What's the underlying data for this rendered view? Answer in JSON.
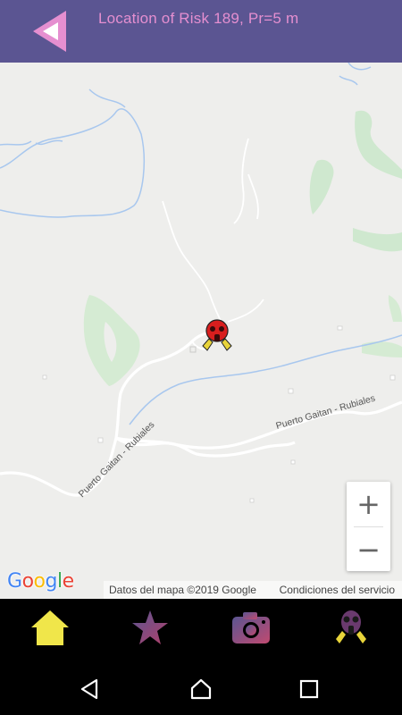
{
  "app_bar": {
    "title": "Location of Risk 189, Pr=5 m",
    "accent_color": "#5b5592",
    "title_color": "#e58fd0",
    "back_icon": "back-triangle-icon"
  },
  "map": {
    "road_labels": [
      "Puerto Gaitan - Rubiales",
      "Puerto Gaitan - Rubiales"
    ],
    "zoom_in_label": "+",
    "zoom_out_label": "−",
    "logo_letters": [
      "G",
      "o",
      "o",
      "g",
      "l",
      "e"
    ],
    "attribution": "Datos del mapa ©2019 Google",
    "terms": "Condiciones del servicio",
    "marker_icon": "gas-mask-marker-icon"
  },
  "bottom_nav": {
    "items": [
      {
        "icon": "home-icon",
        "color": "#f0e64a"
      },
      {
        "icon": "star-icon",
        "color": "#8b3a6e"
      },
      {
        "icon": "camera-icon",
        "color": "#a04a7a"
      },
      {
        "icon": "gas-mask-icon",
        "color": "#7a3a78"
      }
    ]
  },
  "system_nav": {
    "buttons": [
      "back-nav-icon",
      "home-nav-icon",
      "recents-nav-icon"
    ]
  }
}
